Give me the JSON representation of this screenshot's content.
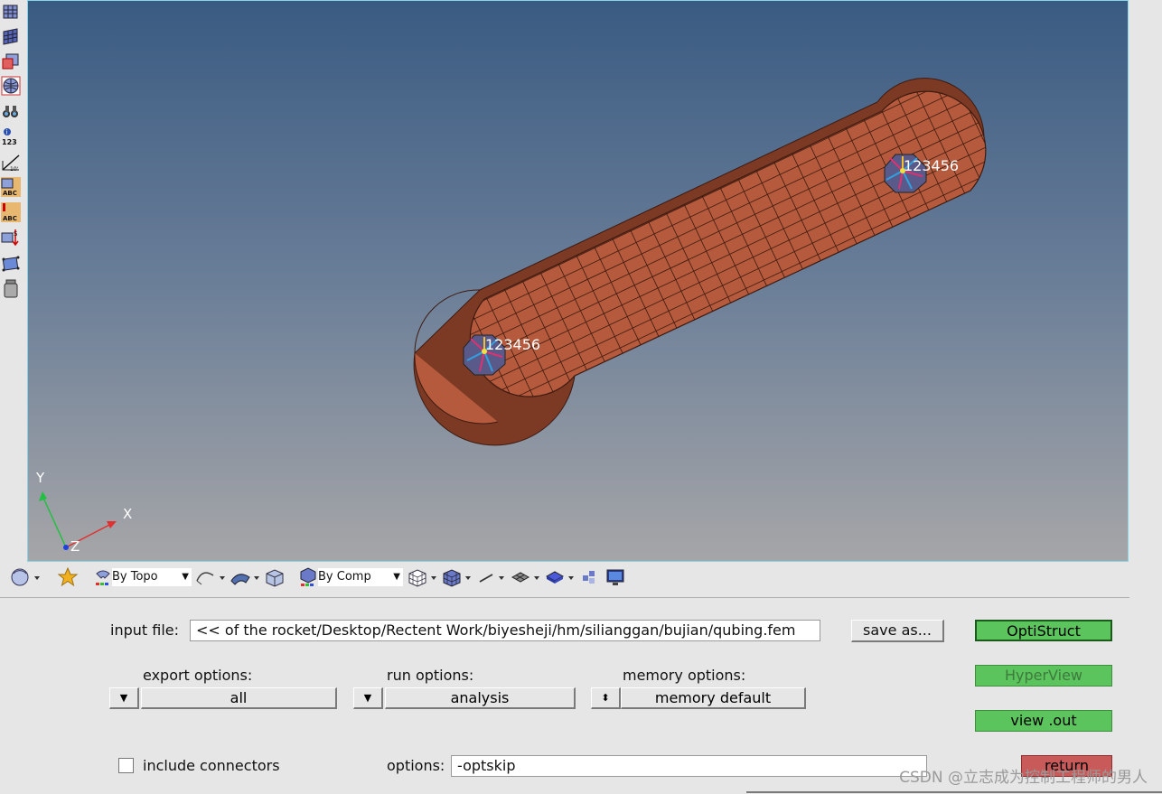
{
  "left_toolbar": {
    "icons": [
      "mesh-grid-icon",
      "mesh-grid-alt-icon",
      "element-cut-icon",
      "sphere-grid-icon",
      "binoculars-icon",
      "info-123-icon",
      "ruler-icon",
      "abc-label-icon",
      "abc-warning-icon",
      "numbering-icon",
      "rectangle-icon",
      "weight-icon"
    ]
  },
  "viewport": {
    "node_labels": [
      "123456",
      "123456"
    ],
    "axis": {
      "x": "X",
      "y": "Y",
      "z": "Z"
    },
    "colors": {
      "part_fill": "#b55a3c",
      "mesh_line": "#3d1a10",
      "bg_top": "#3a5b82",
      "bg_bottom": "#a6a6a8"
    }
  },
  "vis_toolbar": {
    "topo_dropdown": "By Topo",
    "comp_dropdown": "By Comp"
  },
  "panel": {
    "input_file_label": "input file:",
    "input_file_value": "<< of the rocket/Desktop/Rectent Work/biyesheji/hm/silianggan/bujian/qubing.fem",
    "save_as": "save as...",
    "export_label": "export options:",
    "export_value": "all",
    "run_label": "run options:",
    "run_value": "analysis",
    "memory_label": "memory options:",
    "memory_value": "memory default",
    "include_connectors": "include connectors",
    "options_label": "options:",
    "options_value": "-optskip",
    "optistruct": "OptiStruct",
    "hyperview": "HyperView",
    "view_out": "view .out",
    "return": "return"
  },
  "watermark": "CSDN @立志成为控制工程师的男人"
}
